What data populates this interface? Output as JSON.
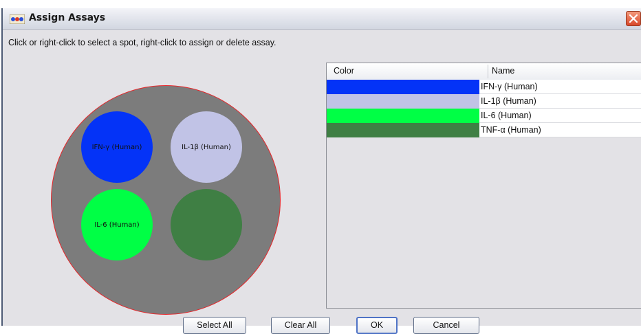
{
  "window": {
    "title": "Assign Assays",
    "app_icon": "dots-app-icon",
    "close_icon": "close-icon"
  },
  "instructions": "Click or right-click to select a spot, right-click to assign or delete assay.",
  "plate": {
    "rim_color": "#e8262a",
    "plate_color": "#7c7c7c",
    "spots": [
      {
        "label": "IFN-γ (Human)",
        "color": "#0433f7"
      },
      {
        "label": "IL-1β (Human)",
        "color": "#c1c3e6"
      },
      {
        "label": "IL-6 (Human)",
        "color": "#00ff45"
      },
      {
        "label": "",
        "color": "#3f7f44"
      }
    ]
  },
  "table": {
    "headers": {
      "color": "Color",
      "name": "Name"
    },
    "rows": [
      {
        "color": "#0433f7",
        "name": "IFN-γ (Human)"
      },
      {
        "color": "#c1c3e6",
        "name": "IL-1β (Human)"
      },
      {
        "color": "#00ff45",
        "name": "IL-6 (Human)"
      },
      {
        "color": "#3f7f44",
        "name": "TNF-α (Human)"
      }
    ]
  },
  "buttons": {
    "select_all": "Select All",
    "clear_all": "Clear All",
    "ok": "OK",
    "cancel": "Cancel"
  }
}
